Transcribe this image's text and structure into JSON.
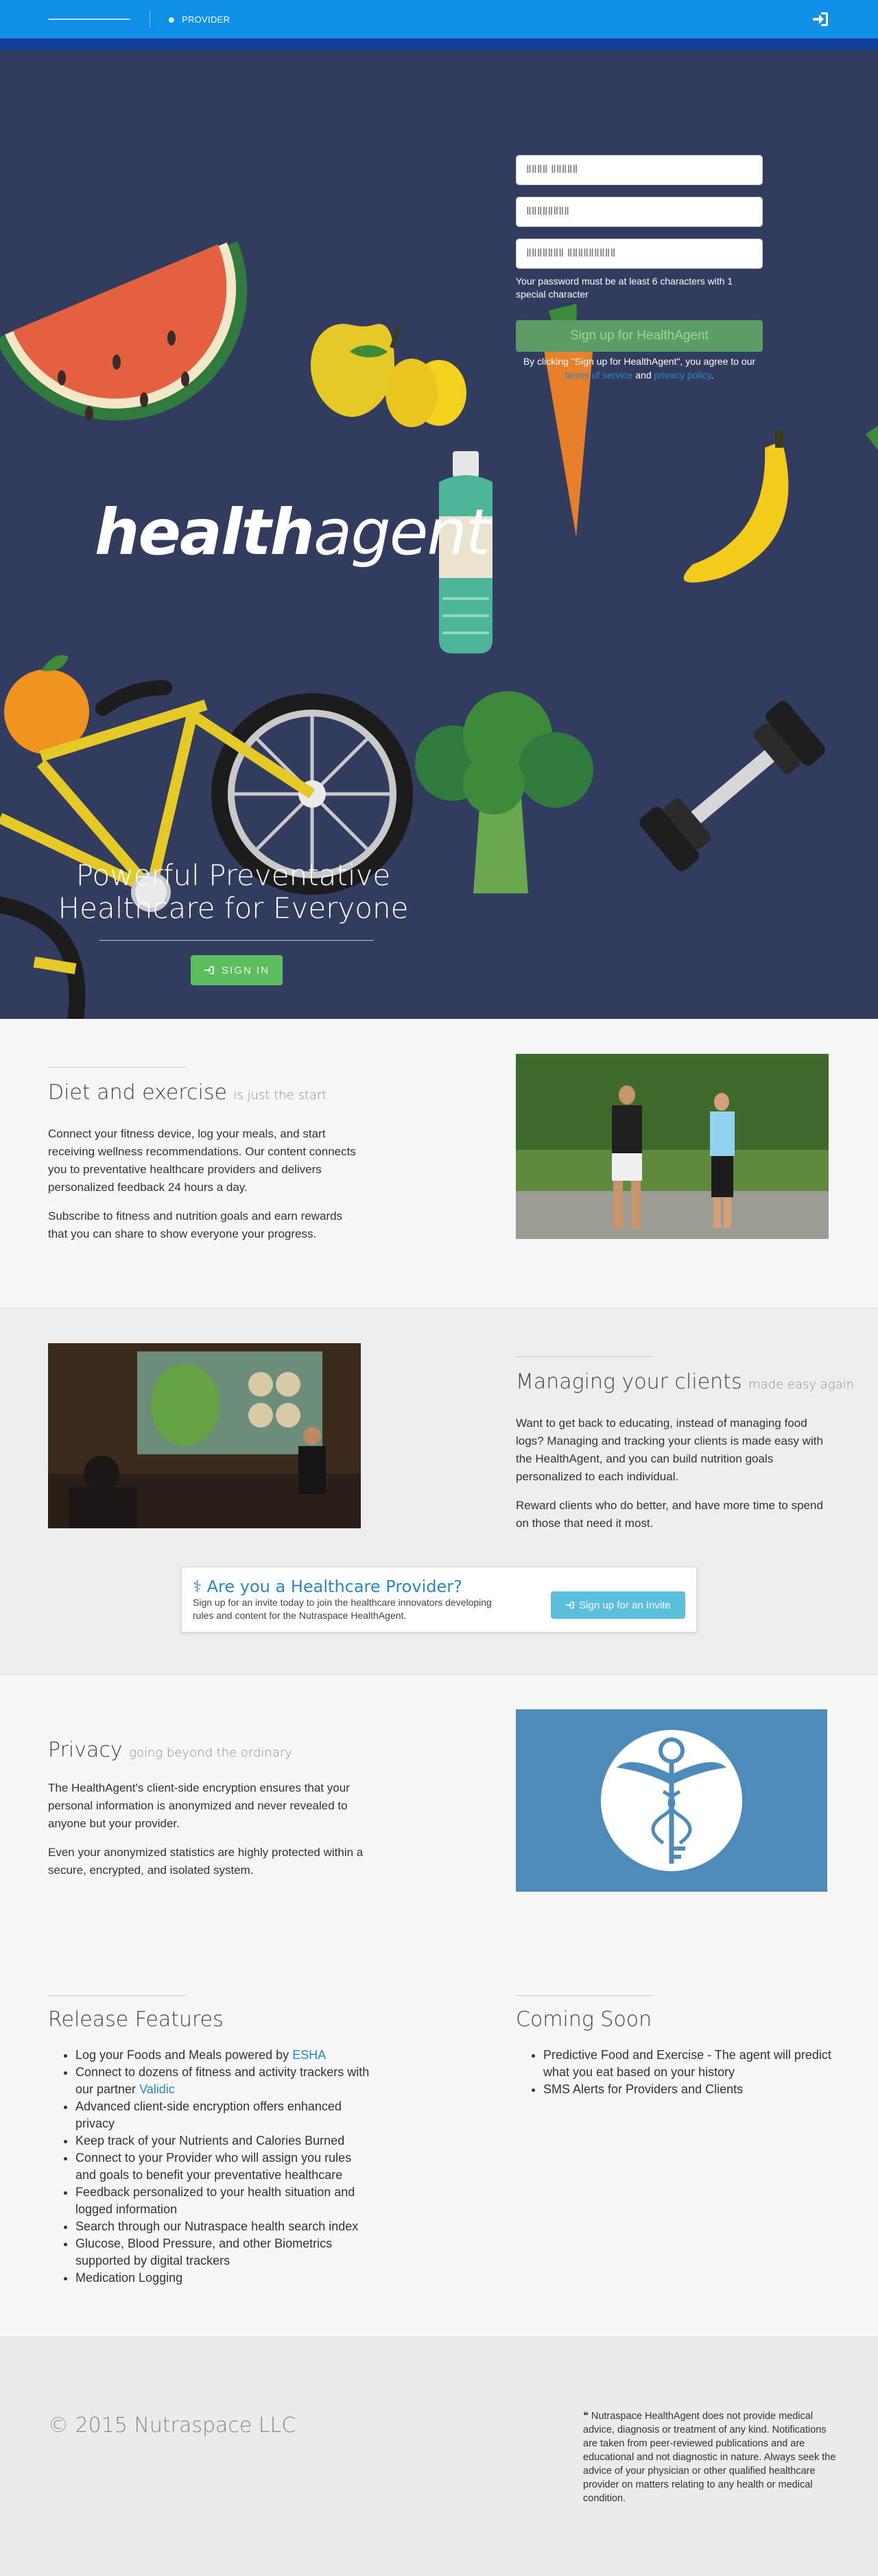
{
  "nav": {
    "provider_label": "PROVIDER"
  },
  "signup": {
    "name_placeholder": "ⅡⅡⅡⅡ ⅡⅡⅡⅡⅡ",
    "email_placeholder": "ⅡⅡⅡⅡⅡⅡⅡⅡ",
    "password_placeholder": "ⅡⅡⅡⅡⅡⅡⅡ ⅡⅡⅡⅡⅡⅡⅡⅡⅡ",
    "password_hint": "Your password must be at least 6 characters with 1 special character",
    "button": "Sign up for HealthAgent",
    "terms_prefix": "By clicking \"Sign up for HealthAgent\", you agree to our",
    "terms_link": "terms of service",
    "terms_and": "and",
    "privacy_link": "privacy policy",
    "terms_suffix": "."
  },
  "hero": {
    "brand_bold": "health",
    "brand_light": "agent",
    "title": "Powerful Preventative Healthcare for Everyone",
    "signin": "SIGN IN"
  },
  "diet": {
    "title": "Diet and exercise",
    "subtitle": "is just the start",
    "p1": "Connect your fitness device, log your meals, and start receiving wellness recommendations. Our content connects you to preventative healthcare providers and delivers personalized feedback 24 hours a day.",
    "p2": "Subscribe to fitness and nutrition goals and earn rewards that you can share to show everyone your progress."
  },
  "clients": {
    "title": "Managing your clients",
    "subtitle": "made easy again",
    "p1": "Want to get back to educating, instead of managing food logs? Managing and tracking your clients is made easy with the HealthAgent, and you can build nutrition goals personalized to each individual.",
    "p2": "Reward clients who do better, and have more time to spend on those that need it most."
  },
  "provider_cta": {
    "title": "Are you a Healthcare Provider?",
    "text": "Sign up for an invite today to join the healthcare innovators developing rules and content for the Nutraspace HealthAgent.",
    "button": "Sign up for an Invite"
  },
  "privacy": {
    "title": "Privacy",
    "subtitle": "going beyond the ordinary",
    "p1": "The HealthAgent's client-side encryption ensures that your personal information is anonymized and never revealed to anyone but your provider.",
    "p2": "Even your anonymized statistics are highly protected within a secure, encrypted, and isolated system."
  },
  "release": {
    "title": "Release Features",
    "items": [
      {
        "text": "Log your Foods and Meals powered by ",
        "link": "ESHA"
      },
      {
        "text": "Connect to dozens of fitness and activity trackers with our partner ",
        "link": "Validic"
      },
      {
        "text": "Advanced client-side encryption offers enhanced privacy",
        "link": ""
      },
      {
        "text": "Keep track of your Nutrients and Calories Burned",
        "link": ""
      },
      {
        "text": "Connect to your Provider who will assign you rules and goals to benefit your preventative healthcare",
        "link": ""
      },
      {
        "text": "Feedback personalized to your health situation and logged information",
        "link": ""
      },
      {
        "text": "Search through our Nutraspace health search index",
        "link": ""
      },
      {
        "text": "Glucose, Blood Pressure, and other Biometrics supported by digital trackers",
        "link": ""
      },
      {
        "text": "Medication Logging",
        "link": ""
      }
    ]
  },
  "coming": {
    "title": "Coming Soon",
    "items": [
      "Predictive Food and Exercise - The agent will predict what you eat based on your history",
      "SMS Alerts for Providers and Clients"
    ]
  },
  "footer": {
    "copyright": "© 2015 Nutraspace LLC",
    "disclaimer": "Nutraspace HealthAgent does not provide medical advice, diagnosis or treatment of any kind. Notifications are taken from peer-reviewed publications and are educational and not diagnostic in nature. Always seek the advice of your physician or other qualified healthcare provider on matters relating to any health or medical condition."
  },
  "colors": {
    "nav": "#0f8fe8",
    "hero_bg": "#323c5e",
    "signup_button": "#5c9d66",
    "signin_button": "#5cbe5e",
    "link": "#2a86c8",
    "cta_button": "#5bc0de"
  },
  "icons": [
    "user-icon",
    "sign-in-icon",
    "user-md-icon",
    "quote-icon"
  ]
}
